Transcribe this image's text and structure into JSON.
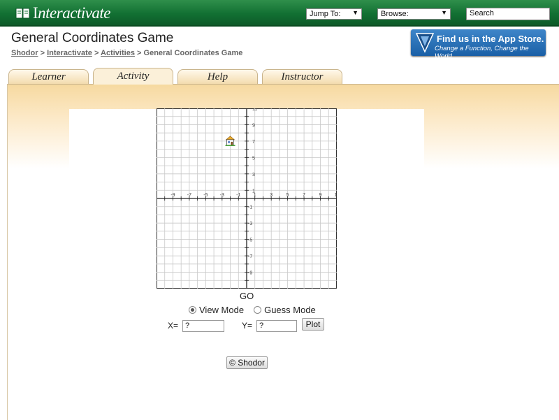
{
  "header": {
    "logo_prefix": "I",
    "logo_rest": "nteractivate",
    "jump_to": "Jump To:",
    "browse": "Browse:",
    "search_placeholder": "Search"
  },
  "page": {
    "title": "General Coordinates Game",
    "breadcrumb": [
      "Shodor",
      "Interactivate",
      "Activities",
      "General Coordinates Game"
    ],
    "breadcrumb_sep": ">"
  },
  "appstore": {
    "line1": "Find us in the App Store.",
    "line2": "Change a Function, Change the World"
  },
  "tabs": [
    {
      "label": "Learner",
      "active": false
    },
    {
      "label": "Activity",
      "active": true
    },
    {
      "label": "Help",
      "active": false
    },
    {
      "label": "Instructor",
      "active": false
    }
  ],
  "grid": {
    "x_labels": [
      "-9",
      "-7",
      "-5",
      "-3",
      "-1",
      "1",
      "3",
      "5",
      "7",
      "9",
      "11"
    ],
    "y_labels_pos": [
      "11",
      "9",
      "7",
      "5",
      "3",
      "1"
    ],
    "y_labels_neg": [
      "-1",
      "-3",
      "-5",
      "-7",
      "-9"
    ],
    "target": {
      "x": -2,
      "y": 7
    },
    "target_icon": "house-icon"
  },
  "controls": {
    "go_label": "GO",
    "view_mode": "View Mode",
    "guess_mode": "Guess Mode",
    "selected_mode": "view",
    "x_label": "X=",
    "y_label": "Y=",
    "x_value": "?",
    "y_value": "?",
    "plot_label": "Plot"
  },
  "footer": {
    "copyright": "© Shodor"
  },
  "colors": {
    "header_green": "#127033",
    "tab_bg": "#f3dcae",
    "appstore_blue": "#1a5fa6"
  }
}
